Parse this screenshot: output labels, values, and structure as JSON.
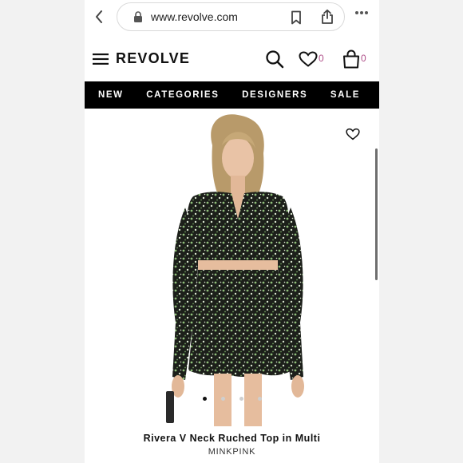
{
  "browser": {
    "url": "www.revolve.com"
  },
  "header": {
    "logo": "REVOLVE",
    "wishlist_count": "0",
    "bag_count": "0"
  },
  "nav": {
    "items": [
      "NEW",
      "CATEGORIES",
      "DESIGNERS",
      "SALE"
    ]
  },
  "product": {
    "name": "Rivera V Neck Ruched Top in Multi",
    "brand": "MINKPINK",
    "image_icon": "model-photo-floral-print",
    "carousel_total": 4,
    "carousel_active_index": 0
  },
  "colors": {
    "nav_background": "#000000",
    "count_accent": "#b0508a"
  }
}
